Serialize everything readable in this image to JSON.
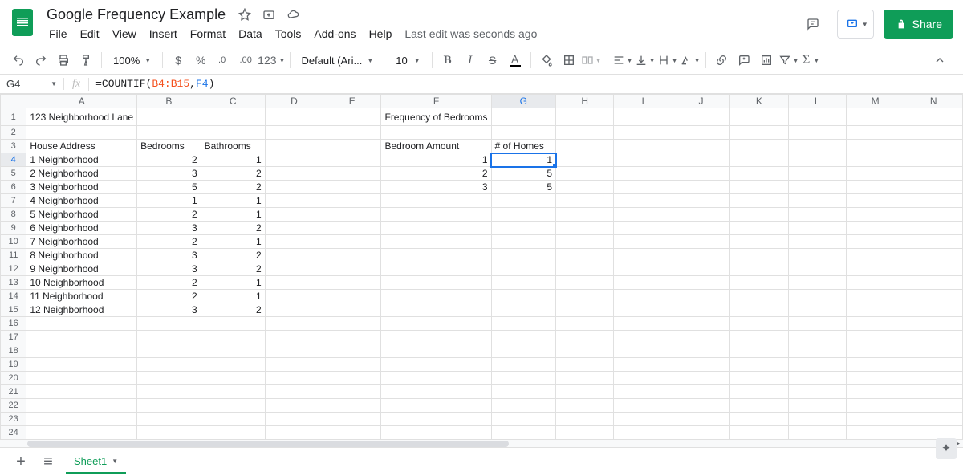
{
  "doc": {
    "title": "Google Frequency Example",
    "last_edit": "Last edit was seconds ago"
  },
  "menu": {
    "file": "File",
    "edit": "Edit",
    "view": "View",
    "insert": "Insert",
    "format": "Format",
    "data": "Data",
    "tools": "Tools",
    "addons": "Add-ons",
    "help": "Help"
  },
  "share": {
    "label": "Share"
  },
  "toolbar": {
    "zoom": "100%",
    "currency": "$",
    "percent": "%",
    "dec_dec": ".0",
    "dec_inc": ".00",
    "numfmt": "123",
    "font": "Default (Ari...",
    "size": "10"
  },
  "namebox": {
    "cell": "G4"
  },
  "formula": {
    "fn_open": "=COUNTIF(",
    "range": "B4:B15",
    "comma": ",",
    "ref": "F4",
    "close": ")"
  },
  "columns": [
    "A",
    "B",
    "C",
    "D",
    "E",
    "F",
    "G",
    "H",
    "I",
    "J",
    "K",
    "L",
    "M",
    "N"
  ],
  "cells": {
    "A1": "123 Neighborhood Lane",
    "F1": "Frequency of Bedrooms",
    "A3": "House Address",
    "B3": "Bedrooms",
    "C3": "Bathrooms",
    "F3": "Bedroom Amount",
    "G3": "# of Homes",
    "A4": "1 Neighborhood",
    "B4": "2",
    "C4": "1",
    "F4": "1",
    "G4": "1",
    "A5": "2 Neighborhood",
    "B5": "3",
    "C5": "2",
    "F5": "2",
    "G5": "5",
    "A6": "3 Neighborhood",
    "B6": "5",
    "C6": "2",
    "F6": "3",
    "G6": "5",
    "A7": "4 Neighborhood",
    "B7": "1",
    "C7": "1",
    "A8": "5 Neighborhood",
    "B8": "2",
    "C8": "1",
    "A9": "6 Neighborhood",
    "B9": "3",
    "C9": "2",
    "A10": "7 Neighborhood",
    "B10": "2",
    "C10": "1",
    "A11": "8 Neighborhood",
    "B11": "3",
    "C11": "2",
    "A12": "9 Neighborhood",
    "B12": "3",
    "C12": "2",
    "A13": "10 Neighborhood",
    "B13": "2",
    "C13": "1",
    "A14": "11 Neighborhood",
    "B14": "2",
    "C14": "1",
    "A15": "12 Neighborhood",
    "B15": "3",
    "C15": "2"
  },
  "sheet_tab": "Sheet1",
  "total_rows": 25,
  "active_cell": "G4"
}
